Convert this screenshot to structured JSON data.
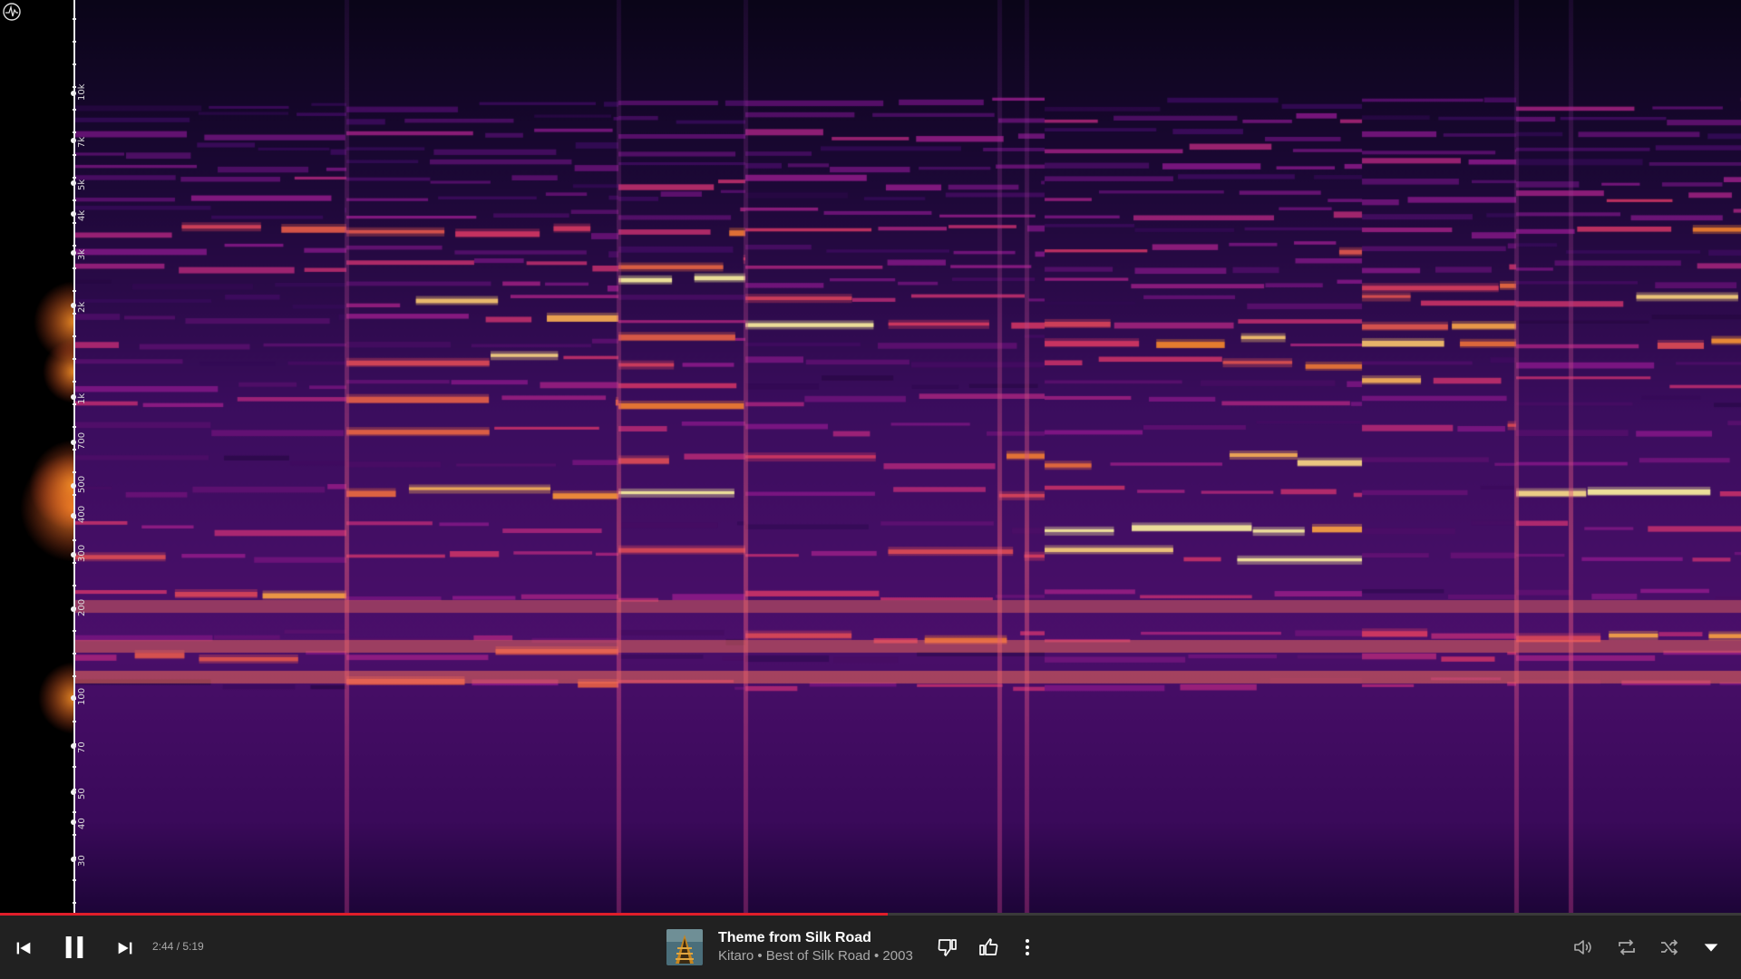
{
  "spectrogram": {
    "axis_labels": [
      "10k",
      "7k",
      "5k",
      "4k",
      "3k",
      "2k",
      "1k",
      "700",
      "500",
      "400",
      "300",
      "200",
      "100",
      "70",
      "50",
      "40",
      "30"
    ]
  },
  "player": {
    "progress_fraction": 0.51,
    "time_display": "2:44 / 5:19",
    "track_title": "Theme from Silk Road",
    "track_subtitle": "Kitaro • Best of Silk Road • 2003",
    "accent_color": "#e01e2a",
    "icons": {
      "prev": "skip-previous-icon",
      "pause": "pause-icon",
      "next": "skip-next-icon",
      "dislike": "thumb-down-icon",
      "like": "thumb-up-icon",
      "more": "more-vert-icon",
      "volume": "volume-icon",
      "repeat": "repeat-icon",
      "shuffle": "shuffle-icon",
      "expand": "expand-caret-icon"
    }
  }
}
